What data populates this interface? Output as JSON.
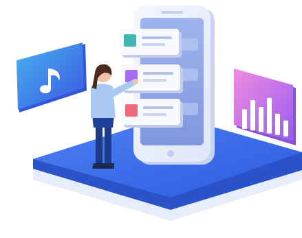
{
  "illustration": {
    "subject": "app-ui-selection",
    "palette": {
      "platform_top": "#3d6ef0",
      "platform_side": "#2a52c9",
      "phone_body": "#e9eefb",
      "phone_screen": "#8fa6e6",
      "card_teal": "#3fb6b0",
      "card_purple": "#a56bf2",
      "card_pink": "#f0687c",
      "music_panel": "#3a7be8",
      "chart_panel": "#c77df0"
    },
    "icons": {
      "music": "music-note-icon",
      "chart": "bar-chart-icon"
    },
    "screen_cards": [
      {
        "name": "screen-card-teal",
        "accent": "#3fb6b0"
      },
      {
        "name": "screen-card-purple",
        "accent": "#a56bf2"
      },
      {
        "name": "screen-card-pink",
        "accent": "#f0687c"
      }
    ],
    "chart_bars": [
      0.55,
      0.85,
      0.7,
      1.0,
      0.6,
      0.45
    ]
  }
}
